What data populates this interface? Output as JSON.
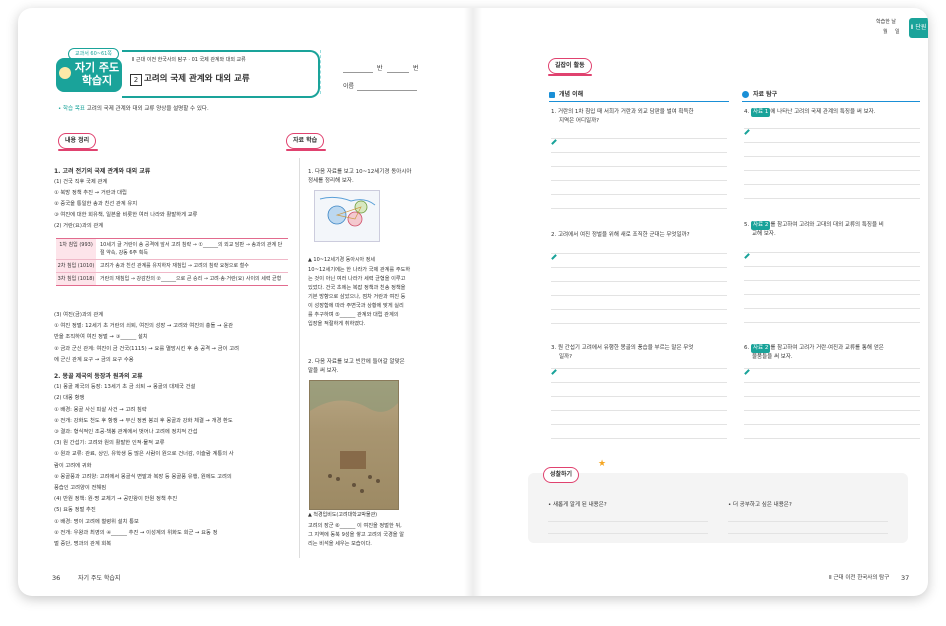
{
  "left": {
    "unit_pill": "교과서 60~61쪽",
    "title": "자기 주도 학습지",
    "breadcrumb": "Ⅱ 근대 이전 한국사의 탐구 · 01 국제 관계와 대외 교류",
    "topic_number": "2",
    "topic_title": "고려의 국제 관계와 대외 교류",
    "class_label": "반",
    "number_label": "번",
    "name_label": "이름",
    "goal_label": "• 학습 목표",
    "goal_text": "고려의 국제 관계와 대외 교류 양상을 설명할 수 있다.",
    "section_summary": "내용 정리",
    "section_source": "자료 학습",
    "summary_lines": [
      {
        "text": "1. 고려 전기의 국제 관계와 대외 교류",
        "bold": true
      },
      {
        "text": "(1) 건국 직후 국제 관계",
        "bold": false
      },
      {
        "text": "① 북방 정책 추진 → 거란과 대립",
        "bold": false
      },
      {
        "text": "② 중국을 통일한 송과 친선 관계 유지",
        "bold": false
      },
      {
        "text": "③ 여진에 대한 회유책, 일본을 비롯한 여러 나라와 활발하게 교류",
        "bold": false
      },
      {
        "text": "(2) 거란(요)과의 관계",
        "bold": false
      }
    ],
    "table": [
      {
        "head": "1차 침입 (993)",
        "body": "10세기 글 거란이 송 공격에 앞서 고려 침략 → ①______의 외교 담판 → 송과의 관계 단절 약속, 강동 6주 획득"
      },
      {
        "head": "2차 침입 (1010)",
        "body": "고려가 송과 친선 관계를 유지하자 재침입 → 고려의 침략 요청으로 철수"
      },
      {
        "head": "3차 침입 (1018)",
        "body": "거란의 재침입 → 강감찬의 ②______으로 큰 승리 → 고려·송·거란(요) 사이의 세력 균형"
      }
    ],
    "summary_lines2": [
      {
        "text": "(3) 여진(금)과의 관계",
        "bold": false
      },
      {
        "text": "① 여진 정벌: 12세기 초 거란의 쇠퇴, 여진의 성장 → 고려와 여진의 충돌 → 윤관",
        "bold": false
      },
      {
        "text": "반을 조직하여 여진 정벌 → ③______ 설치",
        "bold": false
      },
      {
        "text": "② 금과 군신 관계: 여진이 금 건국(1115) → 요를 멸망시킨 후 송 공격 → 금이 고려",
        "bold": false
      },
      {
        "text": "에 군신 관계 요구 → 금의 요구 수용",
        "bold": false
      },
      {
        "text": "2. 몽골 제국의 등장과 원과의 교류",
        "bold": true
      },
      {
        "text": "(1) 몽골 제국의 등장: 13세기 초 금 쇠퇴 → 몽골의 대제국 건설",
        "bold": false
      },
      {
        "text": "(2) 대몽 항쟁",
        "bold": false
      },
      {
        "text": "① 배경: 몽골 사신 피살 사건 → 고려 침략",
        "bold": false
      },
      {
        "text": "② 전개: 강화도 천도 후 항쟁 → 무신 정권 붕괴 후 몽골과 강화 체결 → 개경 환도",
        "bold": false
      },
      {
        "text": "③ 결과: 형식적인 조공·책봉 관계에서 벗어나 고려에 정치적 간섭",
        "bold": false
      },
      {
        "text": "(3) 원 간섭기: 고려와 원의 활발한 인적·물적 교류",
        "bold": false
      },
      {
        "text": "① 원과 교류: 관료, 상인, 유학생 등 많은 사람이 원으로 건너감, 이슬람 계통의 사",
        "bold": false
      },
      {
        "text": "람이 고려에 귀화",
        "bold": false
      },
      {
        "text": "② 몽골풍과 고려양: 고려에서 몽골식 변발과 복장 등 몽골풍 유행, 원에도 고려의",
        "bold": false
      },
      {
        "text": "풍습인 고려양이 전해짐",
        "bold": false
      },
      {
        "text": "(4) 반원 정책: 원·명 교체기 → 공민왕이 반원 정책 추진",
        "bold": false
      },
      {
        "text": "(5) 요동 정벌 추진",
        "bold": false
      },
      {
        "text": "① 배경: 명이 고려에 철령위 설치 통보",
        "bold": false
      },
      {
        "text": "② 전개: 우왕과 최영의 ④______ 추진 → 이성계의 위화도 회군 → 요동 정",
        "bold": false
      },
      {
        "text": "벌 중단, 명과의 관계 회복",
        "bold": false
      }
    ],
    "source_q1": [
      "1. 다음 자료를 보고 10~12세기경 동아시아",
      "정세를 정리해 보자."
    ],
    "map_caption": "▲ 10~12세기경 동아시아 정세",
    "source_paragraph": [
      "10~12세기에는 한 나라가 국제 관계를 주도하",
      "는 것이 아닌 여러 나라가 세력 균형을 이루고",
      "있었다. 건국 초에는 복잡 정책과 친송 정책을",
      "기본 방향으로 삼았으나, 점차 거란과 여진 등",
      "이 성장함에 따라 주변국과 상황에 맞게 실리",
      "를 추구하며 ⑤______ 관계와 대립 관계의",
      "입장을 적절하게 취하였다."
    ],
    "source_q2": [
      "2. 다음 자료를 보고 빈칸에 들어갈 알맞은",
      "말을 써 보자."
    ],
    "paint_caption": "▲ 척경입비도(고려대학교박물관)",
    "source_paragraph2": [
      "고려의 장군 ⑥______ 이 여진을 정벌한 뒤,",
      "그 지역에 동북 9성을 쌓고 고려의 국경을 알",
      "리는 비석을 세우는 모습이다."
    ],
    "page_number": "36",
    "footer": "자기 주도 학습지"
  },
  "right": {
    "corner_label": "학습한 날",
    "corner_month": "월",
    "corner_day": "일",
    "unit_tag": "Ⅱ 단원",
    "section_activity": "길잡이 활동",
    "concept_header": "개념 이해",
    "explore_header": "자료 탐구",
    "q1": [
      "1. 거란의 1차 침입 때 서희가 거란과 외교 담판을 벌여 획득한",
      "지역은 어디일까?"
    ],
    "q2": [
      "2. 고려에서 여진 정벌을 위해 새로 조직한 군대는 무엇일까?"
    ],
    "q3": [
      "3. 원 간섭기 고려에서 유행한 몽골의 풍습을 부르는 말은 무엇",
      "일까?"
    ],
    "q4_prefix": "4.",
    "q4_tag": "자료 1",
    "q4_text": "에 나타난 고려의 국제 관계의 특징을 써 보자.",
    "q5_prefix": "5.",
    "q5_tag": "자료 2",
    "q5_text": [
      "를 참고하여 고려와 고대의 대외 교류의 특징을 비",
      "교해 보자."
    ],
    "q6_prefix": "6.",
    "q6_tag": "자료 2",
    "q6_text": [
      "를 참고하여 고려가 거란·여진과 교류를 통해 얻은",
      "물품들을 써 보자."
    ],
    "reflect_title": "성찰하기",
    "reflect_left": "• 새롭게 알게 된 내용은?",
    "reflect_right": "• 더 공부하고 싶은 내용은?",
    "footer": "Ⅱ 근대 이전 한국사의 탐구",
    "page_number": "37"
  },
  "colors": {
    "teal": "#1aa39a",
    "pink": "#e0426f",
    "blue": "#1a8fd6"
  }
}
